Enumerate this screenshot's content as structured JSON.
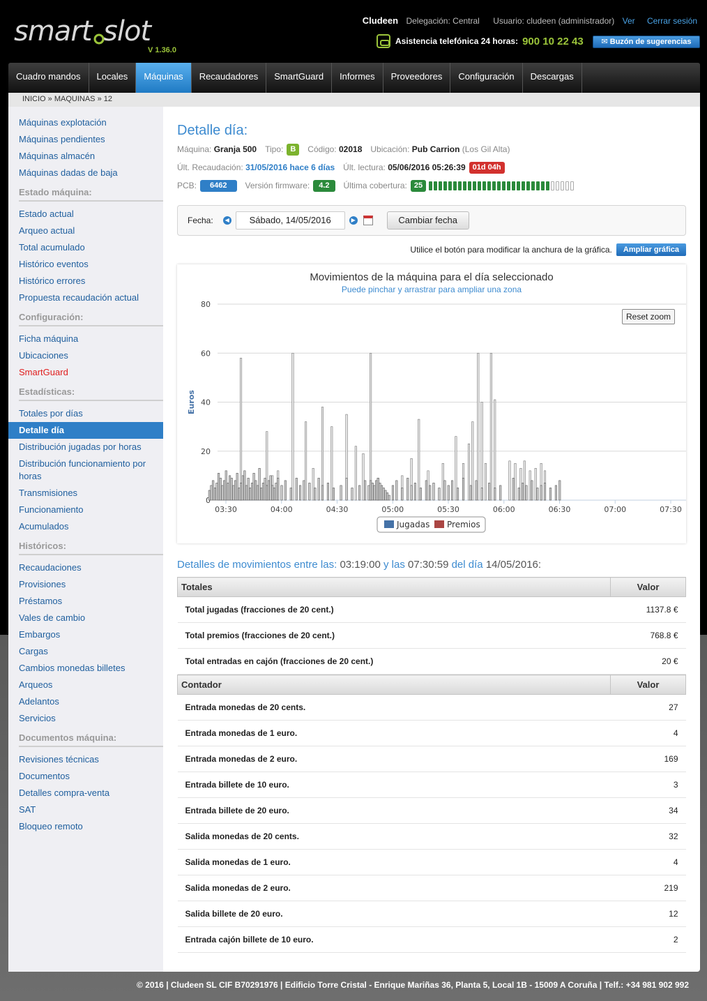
{
  "header": {
    "version": "V 1.36.0",
    "company": "Cludeen",
    "delegacion": "Delegación: Central",
    "usuario": "Usuario: cludeen (administrador)",
    "ver": "Ver",
    "logout": "Cerrar sesión",
    "phone_label": "Asistencia telefónica 24 horas:",
    "phone_number": "900 10 22 43",
    "suggest": "Buzón de sugerencias"
  },
  "nav": [
    "Cuadro mandos",
    "Locales",
    "Máquinas",
    "Recaudadores",
    "SmartGuard",
    "Informes",
    "Proveedores",
    "Configuración",
    "Descargas"
  ],
  "breadcrumb": "INICIO » MAQUINAS » 12",
  "sidebar": {
    "g1": [
      "Máquinas explotación",
      "Máquinas pendientes",
      "Máquinas almacén",
      "Máquinas dadas de baja"
    ],
    "h2": "Estado máquina:",
    "g2": [
      "Estado actual",
      "Arqueo actual",
      "Total acumulado",
      "Histórico eventos",
      "Histórico errores",
      "Propuesta recaudación actual"
    ],
    "h3": "Configuración:",
    "g3": [
      "Ficha máquina",
      "Ubicaciones",
      "SmartGuard"
    ],
    "h4": "Estadísticas:",
    "g4": [
      "Totales por días",
      "Detalle día",
      "Distribución jugadas por horas",
      "Distribución funcionamiento por horas",
      "Transmisiones",
      "Funcionamiento",
      "Acumulados"
    ],
    "h5": "Históricos:",
    "g5": [
      "Recaudaciones",
      "Provisiones",
      "Préstamos",
      "Vales de cambio",
      "Embargos",
      "Cargas",
      "Cambios monedas billetes",
      "Arqueos",
      "Adelantos",
      "Servicios"
    ],
    "h6": "Documentos máquina:",
    "g6": [
      "Revisiones técnicas",
      "Documentos",
      "Detalles compra-venta",
      "SAT",
      "Bloqueo remoto"
    ]
  },
  "detail": {
    "title": "Detalle día:",
    "maquina_l": "Máquina:",
    "maquina": "Granja 500",
    "tipo_l": "Tipo:",
    "tipo": "B",
    "codigo_l": "Código:",
    "codigo": "02018",
    "ubic_l": "Ubicación:",
    "ubic": "Pub Carrion",
    "ubic2": "(Los Gil Alta)",
    "recaud_l": "Últ. Recaudación:",
    "recaud": "31/05/2016 hace 6 días",
    "lectura_l": "Últ. lectura:",
    "lectura": "05/06/2016 05:26:39",
    "lectura_badge": "01d 04h",
    "pcb_l": "PCB:",
    "pcb": "6462",
    "firm_l": "Versión firmware:",
    "firm": "4.2",
    "cob_l": "Última cobertura:",
    "cob": "25",
    "cob_level": 25,
    "cob_max": 30
  },
  "datebar": {
    "label": "Fecha:",
    "date": "Sábado, 14/05/2016",
    "button": "Cambiar fecha"
  },
  "widen": {
    "text": "Utilice el botón para modificar la anchura de la gráfica.",
    "button": "Ampliar gráfica"
  },
  "chart_data": {
    "type": "bar",
    "title": "Movimientos de la máquina para el día seleccionado",
    "subtitle": "Puede pinchar y arrastrar para ampliar una zona",
    "ylabel": "Euros",
    "ylim": [
      0,
      80
    ],
    "yticks": [
      0,
      20,
      40,
      60,
      80
    ],
    "xticks": [
      "03:30",
      "04:00",
      "04:30",
      "05:00",
      "05:30",
      "06:00",
      "06:30",
      "07:00",
      "07:30"
    ],
    "reset": "Reset zoom",
    "series": [
      {
        "name": "Jugadas",
        "color": "#4572a7",
        "points": [
          [
            "03:21",
            4
          ],
          [
            "03:22",
            6
          ],
          [
            "03:23",
            8
          ],
          [
            "03:24",
            5
          ],
          [
            "03:25",
            7
          ],
          [
            "03:26",
            11
          ],
          [
            "03:27",
            9
          ],
          [
            "03:28",
            6
          ],
          [
            "03:29",
            8
          ],
          [
            "03:30",
            12
          ],
          [
            "03:31",
            7
          ],
          [
            "03:32",
            10
          ],
          [
            "03:33",
            9
          ],
          [
            "03:34",
            6
          ],
          [
            "03:35",
            8
          ],
          [
            "03:36",
            11
          ],
          [
            "03:37",
            5
          ],
          [
            "03:38",
            7
          ],
          [
            "03:39",
            10
          ],
          [
            "03:40",
            12
          ],
          [
            "03:41",
            6
          ],
          [
            "03:42",
            9
          ],
          [
            "03:43",
            5
          ],
          [
            "03:44",
            7
          ],
          [
            "03:45",
            11
          ],
          [
            "03:46",
            8
          ],
          [
            "03:47",
            6
          ],
          [
            "03:48",
            13
          ],
          [
            "03:49",
            5
          ],
          [
            "03:50",
            7
          ],
          [
            "03:51",
            9
          ],
          [
            "03:52",
            6
          ],
          [
            "03:53",
            8
          ],
          [
            "03:54",
            10
          ],
          [
            "03:55",
            6
          ],
          [
            "03:56",
            5
          ],
          [
            "03:57",
            7
          ],
          [
            "03:58",
            9
          ],
          [
            "04:00",
            6
          ],
          [
            "04:02",
            8
          ],
          [
            "04:05",
            5
          ],
          [
            "04:08",
            9
          ],
          [
            "04:10",
            6
          ],
          [
            "04:12",
            8
          ],
          [
            "04:15",
            7
          ],
          [
            "04:18",
            5
          ],
          [
            "04:20",
            9
          ],
          [
            "04:22",
            6
          ],
          [
            "04:25",
            7
          ],
          [
            "04:28",
            5
          ],
          [
            "04:32",
            6
          ],
          [
            "04:35",
            9
          ],
          [
            "04:38",
            5
          ],
          [
            "04:42",
            6
          ],
          [
            "04:45",
            8
          ],
          [
            "04:47",
            6
          ],
          [
            "04:48",
            8
          ],
          [
            "04:49",
            7
          ],
          [
            "04:50",
            6
          ],
          [
            "04:51",
            8
          ],
          [
            "04:52",
            9
          ],
          [
            "04:53",
            7
          ],
          [
            "04:54",
            6
          ],
          [
            "04:55",
            5
          ],
          [
            "04:56",
            4
          ],
          [
            "04:57",
            3
          ],
          [
            "04:58",
            2
          ],
          [
            "05:00",
            6
          ],
          [
            "05:02",
            8
          ],
          [
            "05:05",
            5
          ],
          [
            "05:08",
            9
          ],
          [
            "05:10",
            6
          ],
          [
            "05:12",
            7
          ],
          [
            "05:15",
            5
          ],
          [
            "05:18",
            8
          ],
          [
            "05:20",
            6
          ],
          [
            "05:22",
            7
          ],
          [
            "05:25",
            5
          ],
          [
            "05:28",
            8
          ],
          [
            "05:30",
            6
          ],
          [
            "05:32",
            8
          ],
          [
            "05:35",
            5
          ],
          [
            "05:38",
            9
          ],
          [
            "05:42",
            6
          ],
          [
            "05:45",
            8
          ],
          [
            "05:48",
            5
          ],
          [
            "05:52",
            7
          ],
          [
            "05:55",
            5
          ],
          [
            "05:58",
            6
          ],
          [
            "06:05",
            9
          ],
          [
            "06:08",
            5
          ],
          [
            "06:10",
            7
          ],
          [
            "06:12",
            6
          ],
          [
            "06:15",
            8
          ],
          [
            "06:18",
            5
          ],
          [
            "06:20",
            6
          ],
          [
            "06:22",
            7
          ],
          [
            "06:25",
            5
          ],
          [
            "06:28",
            6
          ],
          [
            "06:30",
            8
          ]
        ]
      },
      {
        "name": "Premios",
        "color": "#aa4643",
        "points": [
          [
            "03:38",
            58
          ],
          [
            "03:52",
            28
          ],
          [
            "03:55",
            10
          ],
          [
            "03:58",
            12
          ],
          [
            "04:06",
            60
          ],
          [
            "04:13",
            32
          ],
          [
            "04:17",
            13
          ],
          [
            "04:22",
            38
          ],
          [
            "04:27",
            30
          ],
          [
            "04:35",
            35
          ],
          [
            "04:40",
            22
          ],
          [
            "04:44",
            19
          ],
          [
            "04:48",
            60
          ],
          [
            "04:52",
            9
          ],
          [
            "05:05",
            10
          ],
          [
            "05:10",
            17
          ],
          [
            "05:14",
            33
          ],
          [
            "05:19",
            12
          ],
          [
            "05:27",
            15
          ],
          [
            "05:34",
            26
          ],
          [
            "05:38",
            15
          ],
          [
            "05:41",
            23
          ],
          [
            "05:43",
            32
          ],
          [
            "05:46",
            60
          ],
          [
            "05:48",
            40
          ],
          [
            "05:50",
            15
          ],
          [
            "05:53",
            60
          ],
          [
            "05:55",
            41
          ],
          [
            "06:03",
            16
          ],
          [
            "06:06",
            15
          ],
          [
            "06:09",
            13
          ],
          [
            "06:11",
            16
          ],
          [
            "06:14",
            12
          ],
          [
            "06:17",
            13
          ],
          [
            "06:20",
            15
          ],
          [
            "06:22",
            12
          ]
        ]
      }
    ]
  },
  "movements": {
    "prefix": "Detalles de movimientos entre las:",
    "from": "03:19:00",
    "mid": "y las",
    "to": "07:30:59",
    "suffix": "del día",
    "day": "14/05/2016:"
  },
  "totals": {
    "h1": "Totales",
    "h2": "Valor",
    "rows": [
      [
        "Total jugadas (fracciones de 20 cent.)",
        "1137.8 €"
      ],
      [
        "Total premios (fracciones de 20 cent.)",
        "768.8 €"
      ],
      [
        "Total entradas en cajón (fracciones de 20 cent.)",
        "20 €"
      ]
    ]
  },
  "counters": {
    "h1": "Contador",
    "h2": "Valor",
    "rows": [
      [
        "Entrada monedas de 20 cents.",
        "27"
      ],
      [
        "Entrada monedas de 1 euro.",
        "4"
      ],
      [
        "Entrada monedas de 2 euro.",
        "169"
      ],
      [
        "Entrada billete de 10 euro.",
        "3"
      ],
      [
        "Entrada billete de 20 euro.",
        "34"
      ],
      [
        "Salida monedas de 20 cents.",
        "32"
      ],
      [
        "Salida monedas de 1 euro.",
        "4"
      ],
      [
        "Salida monedas de 2 euro.",
        "219"
      ],
      [
        "Salida billete de 20 euro.",
        "12"
      ],
      [
        "Entrada cajón billete de 10 euro.",
        "2"
      ]
    ]
  },
  "footer": "© 2016 | Cludeen SL CIF B70291976 | Edificio Torre Cristal - Enrique Mariñas 36, Planta 5, Local 1B - 15009 A Coruña | Telf.: +34 981 902 992"
}
